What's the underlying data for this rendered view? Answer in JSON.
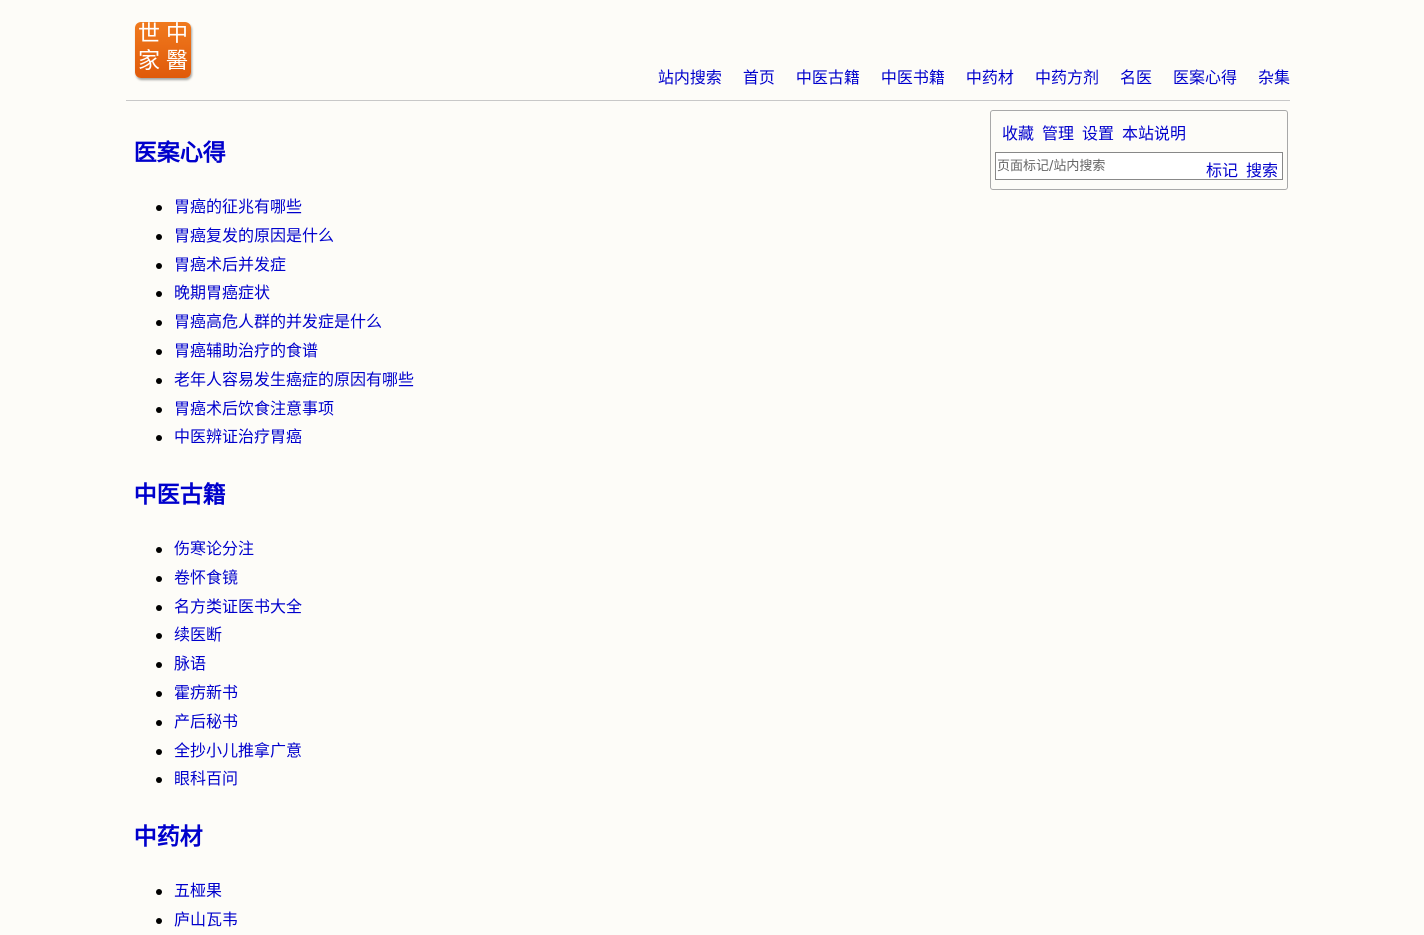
{
  "logo": {
    "chars": [
      "世",
      "中",
      "家",
      "醫"
    ]
  },
  "nav": [
    "站内搜索",
    "首页",
    "中医古籍",
    "中医书籍",
    "中药材",
    "中药方剂",
    "名医",
    "医案心得",
    "杂集"
  ],
  "toolbox": {
    "links": [
      "收藏",
      "管理",
      "设置",
      "本站说明"
    ],
    "search_placeholder": "页面标记/站内搜索",
    "mark_label": "标记",
    "search_label": "搜索"
  },
  "sections": [
    {
      "title": "医案心得",
      "items": [
        "胃癌的征兆有哪些",
        "胃癌复发的原因是什么",
        "胃癌术后并发症",
        "晚期胃癌症状",
        "胃癌高危人群的并发症是什么",
        "胃癌辅助治疗的食谱",
        "老年人容易发生癌症的原因有哪些",
        "胃癌术后饮食注意事项",
        "中医辨证治疗胃癌"
      ]
    },
    {
      "title": "中医古籍",
      "items": [
        "伤寒论分注",
        "卷怀食镜",
        "名方类证医书大全",
        "续医断",
        "脉语",
        "霍疠新书",
        "产后秘书",
        "全抄小儿推拿广意",
        "眼科百问"
      ]
    },
    {
      "title": "中药材",
      "items": [
        "五桠果",
        "庐山瓦韦"
      ]
    }
  ]
}
